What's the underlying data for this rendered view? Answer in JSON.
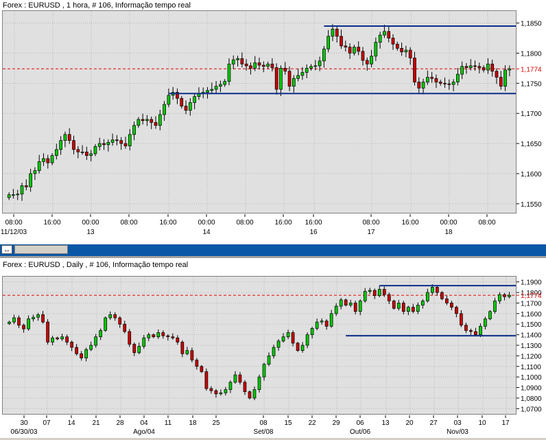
{
  "colors": {
    "bull": "#00c800",
    "bear": "#c80000",
    "band": "#0a2d8c",
    "current": "#e00000",
    "grid": "#b8b8b8"
  },
  "hourly": {
    "title": "Forex : EURUSD , 1 hora, # 106, Informação tempo real",
    "current_label": "1,1774",
    "y_ticks": [
      "1,1850",
      "1,1800",
      "1,1750",
      "1,1700",
      "1,1650",
      "1,1600",
      "1,1550"
    ],
    "x_ticks": [
      {
        "time": "08:00",
        "date": "11/12/03"
      },
      {
        "time": "16:00",
        "date": ""
      },
      {
        "time": "00:00",
        "date": "13"
      },
      {
        "time": "08:00",
        "date": ""
      },
      {
        "time": "16:00",
        "date": ""
      },
      {
        "time": "00:00",
        "date": "14"
      },
      {
        "time": "08:00",
        "date": ""
      },
      {
        "time": "16:00",
        "date": ""
      },
      {
        "time": "16:00",
        "date": "16"
      },
      {
        "time": "08:00",
        "date": "17"
      },
      {
        "time": "16:00",
        "date": ""
      },
      {
        "time": "00:00",
        "date": "18"
      },
      {
        "time": "08:00",
        "date": ""
      }
    ]
  },
  "daily": {
    "title": "Forex : EURUSD , Daily , # 106, Informação tempo real",
    "current_label": "1,1774",
    "y_ticks": [
      "1,1900",
      "1,1800",
      "1,1700",
      "1,1600",
      "1,1500",
      "1,1400",
      "1,1300",
      "1,1200",
      "1,1100",
      "1,1000",
      "1,0900",
      "1,0800",
      "1,0700"
    ],
    "x_ticks": [
      {
        "day": "30",
        "month": "06/30/03"
      },
      {
        "day": "07",
        "month": ""
      },
      {
        "day": "14",
        "month": ""
      },
      {
        "day": "21",
        "month": ""
      },
      {
        "day": "28",
        "month": ""
      },
      {
        "day": "04",
        "month": "Ago/04"
      },
      {
        "day": "11",
        "month": ""
      },
      {
        "day": "18",
        "month": ""
      },
      {
        "day": "25",
        "month": ""
      },
      {
        "day": "08",
        "month": "Set/08"
      },
      {
        "day": "15",
        "month": ""
      },
      {
        "day": "22",
        "month": ""
      },
      {
        "day": "29",
        "month": ""
      },
      {
        "day": "06",
        "month": "Out/06"
      },
      {
        "day": "13",
        "month": ""
      },
      {
        "day": "20",
        "month": ""
      },
      {
        "day": "27",
        "month": ""
      },
      {
        "day": "03",
        "month": "Nov/03"
      },
      {
        "day": "10",
        "month": ""
      },
      {
        "day": "17",
        "month": ""
      }
    ]
  },
  "chart_data": [
    {
      "type": "candlestick",
      "title": "Forex : EURUSD , 1 hora, # 106, Informação tempo real",
      "ylim": [
        1.1535,
        1.187
      ],
      "current_price": 1.1774,
      "grid": true,
      "support_resistance": [
        {
          "level": 1.1845,
          "from_candle": 73,
          "to_candle": 125
        },
        {
          "level": 1.1733,
          "from_candle": 37,
          "to_candle": 125
        }
      ],
      "closes": [
        1.1565,
        1.1565,
        1.1566,
        1.158,
        1.1578,
        1.16,
        1.1605,
        1.162,
        1.1625,
        1.1618,
        1.163,
        1.164,
        1.1655,
        1.1665,
        1.1655,
        1.164,
        1.1636,
        1.1636,
        1.163,
        1.1633,
        1.1645,
        1.165,
        1.1648,
        1.1652,
        1.1656,
        1.1655,
        1.165,
        1.1646,
        1.1665,
        1.168,
        1.169,
        1.1688,
        1.169,
        1.1685,
        1.168,
        1.1698,
        1.1715,
        1.173,
        1.1735,
        1.1725,
        1.1712,
        1.1705,
        1.1718,
        1.1728,
        1.1733,
        1.1735,
        1.1738,
        1.174,
        1.1745,
        1.1748,
        1.1753,
        1.1782,
        1.1789,
        1.1791,
        1.1782,
        1.1779,
        1.1775,
        1.1784,
        1.178,
        1.1778,
        1.1782,
        1.1776,
        1.174,
        1.1775,
        1.177,
        1.1745,
        1.1758,
        1.1763,
        1.1768,
        1.1775,
        1.1778,
        1.1779,
        1.1787,
        1.1807,
        1.1828,
        1.184,
        1.1828,
        1.1812,
        1.181,
        1.18,
        1.181,
        1.1803,
        1.1788,
        1.1782,
        1.1795,
        1.1818,
        1.183,
        1.1836,
        1.1825,
        1.1815,
        1.1808,
        1.1802,
        1.1805,
        1.1792,
        1.1752,
        1.1742,
        1.1752,
        1.176,
        1.1758,
        1.1752,
        1.175,
        1.1749,
        1.1748,
        1.1752,
        1.1765,
        1.1778,
        1.1776,
        1.1779,
        1.1778,
        1.1776,
        1.1772,
        1.1782,
        1.177,
        1.176,
        1.1745,
        1.1772,
        1.1774
      ],
      "tokens": "candles are drawn from closes with open = previous close"
    },
    {
      "type": "candlestick",
      "title": "Forex : EURUSD , Daily , # 106, Informação tempo real",
      "ylim": [
        1.065,
        1.195
      ],
      "current_price": 1.1774,
      "grid": true,
      "support_resistance": [
        {
          "level": 1.1865,
          "from_candle": 77,
          "to_candle": 105
        },
        {
          "level": 1.139,
          "from_candle": 70,
          "to_candle": 105
        }
      ],
      "closes": [
        1.152,
        1.156,
        1.149,
        1.1455,
        1.155,
        1.1565,
        1.159,
        1.152,
        1.133,
        1.137,
        1.136,
        1.138,
        1.133,
        1.128,
        1.122,
        1.118,
        1.126,
        1.13,
        1.138,
        1.144,
        1.156,
        1.159,
        1.156,
        1.15,
        1.143,
        1.131,
        1.123,
        1.129,
        1.137,
        1.14,
        1.138,
        1.142,
        1.139,
        1.138,
        1.137,
        1.133,
        1.122,
        1.125,
        1.116,
        1.11,
        1.105,
        1.089,
        1.087,
        1.084,
        1.085,
        1.088,
        1.095,
        1.102,
        1.095,
        1.086,
        1.08,
        1.088,
        1.1,
        1.112,
        1.12,
        1.128,
        1.134,
        1.138,
        1.142,
        1.132,
        1.125,
        1.13,
        1.14,
        1.146,
        1.152,
        1.153,
        1.148,
        1.16,
        1.167,
        1.173,
        1.168,
        1.17,
        1.162,
        1.172,
        1.181,
        1.182,
        1.177,
        1.183,
        1.178,
        1.172,
        1.165,
        1.17,
        1.162,
        1.166,
        1.162,
        1.168,
        1.172,
        1.18,
        1.185,
        1.18,
        1.174,
        1.17,
        1.166,
        1.16,
        1.149,
        1.144,
        1.143,
        1.14,
        1.148,
        1.155,
        1.162,
        1.172,
        1.178,
        1.176,
        1.1774
      ]
    }
  ]
}
